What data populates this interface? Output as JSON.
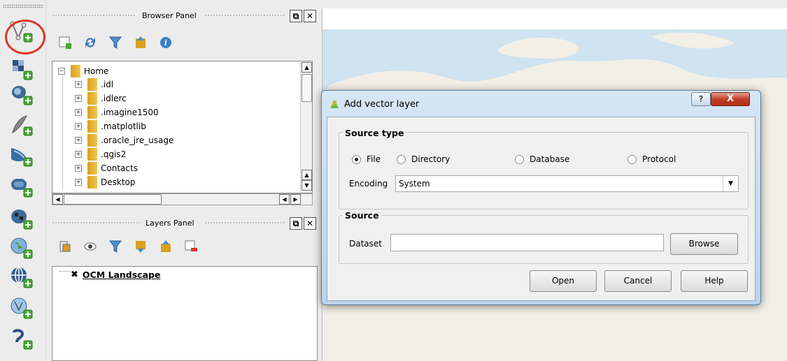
{
  "left_toolbar": {
    "icons": [
      "add-vector-layer-icon",
      "add-raster-layer-icon",
      "add-postgis-layer-icon",
      "add-spatialite-layer-icon",
      "add-mssql-layer-icon",
      "add-oracle-layer-icon",
      "add-db2-layer-icon",
      "add-wms-layer-icon",
      "add-wcs-layer-icon",
      "add-wfs-layer-icon",
      "add-delimited-text-layer-icon"
    ]
  },
  "browser_panel": {
    "title": "Browser Panel",
    "toolbar_icons": [
      "add-selected-layers-icon",
      "refresh-icon",
      "filter-icon",
      "collapse-all-icon",
      "properties-icon"
    ],
    "tree": {
      "root": "Home",
      "items": [
        ".idl",
        ".idlerc",
        ".imagine1500",
        ".matplotlib",
        ".oracle_jre_usage",
        ".qgis2",
        "Contacts",
        "Desktop"
      ]
    }
  },
  "layers_panel": {
    "title": "Layers Panel",
    "toolbar_icons": [
      "open-layer-styling-icon",
      "manage-map-themes-icon",
      "filter-legend-icon",
      "expand-all-icon",
      "collapse-all-icon",
      "remove-layer-icon"
    ],
    "layers": [
      {
        "name": "OCM Landscape",
        "checked": true
      }
    ]
  },
  "dialog": {
    "title": "Add vector layer",
    "help_glyph": "?",
    "close_glyph": "X",
    "source_type": {
      "label": "Source type",
      "options": [
        "File",
        "Directory",
        "Database",
        "Protocol"
      ],
      "selected": "File",
      "encoding_label": "Encoding",
      "encoding_value": "System"
    },
    "source": {
      "label": "Source",
      "dataset_label": "Dataset",
      "dataset_value": "",
      "browse_label": "Browse"
    },
    "buttons": {
      "open": "Open",
      "cancel": "Cancel",
      "help": "Help"
    }
  },
  "colors": {
    "highlight_ring": "#e0342a",
    "map_water": "#cfe3f0",
    "close_button": "#c33e28"
  }
}
